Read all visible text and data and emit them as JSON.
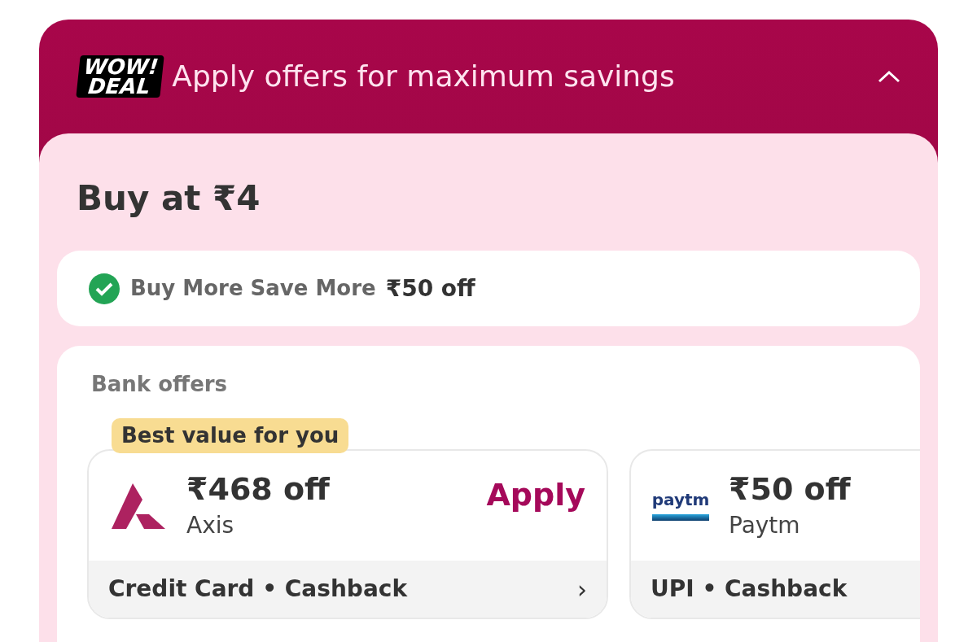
{
  "header": {
    "badge": [
      "WOW!",
      "DEAL"
    ],
    "title": "Apply offers for maximum savings",
    "expanded": true
  },
  "price": {
    "title": "Buy at ₹4"
  },
  "offer_strip": {
    "checked": true,
    "label": "Buy More Save More",
    "value": "₹50 off"
  },
  "bank_offers": {
    "title": "Bank offers",
    "cards": [
      {
        "kind": "axis",
        "tag": "Best value for you",
        "amount": "₹468 off",
        "bank": "Axis",
        "action": "Apply",
        "footer": "Credit Card • Cashback",
        "chevron": "›"
      },
      {
        "kind": "paytm",
        "logo_text": "paytm",
        "amount": "₹50 off",
        "bank": "Paytm",
        "footer": "UPI • Cashback"
      }
    ]
  }
}
